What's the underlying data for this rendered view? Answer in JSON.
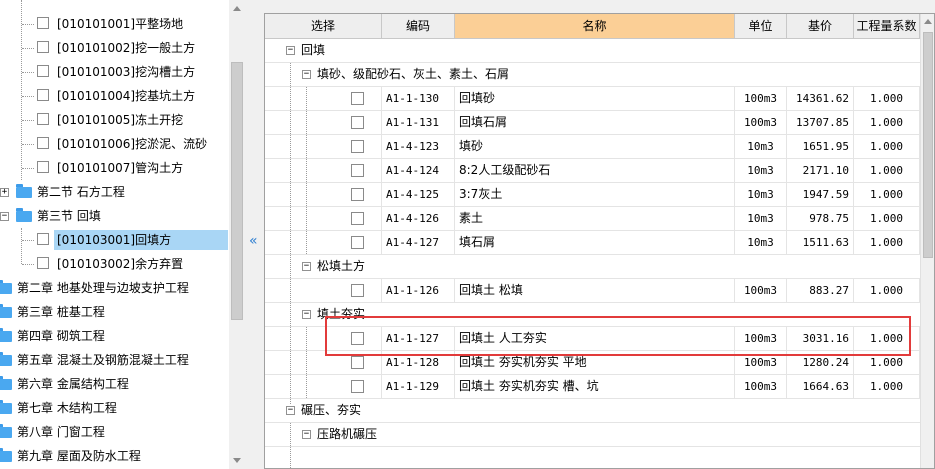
{
  "tree": {
    "items": [
      {
        "label": "[010101001]平整场地",
        "kind": "leaf"
      },
      {
        "label": "[010101002]挖一般土方",
        "kind": "leaf"
      },
      {
        "label": "[010101003]挖沟槽土方",
        "kind": "leaf"
      },
      {
        "label": "[010101004]挖基坑土方",
        "kind": "leaf"
      },
      {
        "label": "[010101005]冻土开挖",
        "kind": "leaf"
      },
      {
        "label": "[010101006]挖淤泥、流砂",
        "kind": "leaf"
      },
      {
        "label": "[010101007]管沟土方",
        "kind": "leaf"
      },
      {
        "label": "第二节   石方工程",
        "kind": "section",
        "expander": "+"
      },
      {
        "label": "第三节   回填",
        "kind": "section",
        "expander": "−"
      },
      {
        "label": "[010103001]回填方",
        "kind": "leaf",
        "selected": true
      },
      {
        "label": "[010103002]余方弃置",
        "kind": "leaf"
      },
      {
        "label": "第二章   地基处理与边坡支护工程",
        "kind": "chapter"
      },
      {
        "label": "第三章   桩基工程",
        "kind": "chapter"
      },
      {
        "label": "第四章   砌筑工程",
        "kind": "chapter"
      },
      {
        "label": "第五章   混凝土及钢筋混凝土工程",
        "kind": "chapter"
      },
      {
        "label": "第六章   金属结构工程",
        "kind": "chapter"
      },
      {
        "label": "第七章   木结构工程",
        "kind": "chapter"
      },
      {
        "label": "第八章   门窗工程",
        "kind": "chapter"
      },
      {
        "label": "第九章   屋面及防水工程",
        "kind": "chapter"
      }
    ]
  },
  "grid": {
    "headers": [
      "选择",
      "编码",
      "名称",
      "单位",
      "基价",
      "工程量系数"
    ],
    "groups": {
      "g1": "回填",
      "g1a": "填砂、级配砂石、灰土、素土、石屑",
      "g1b": "松填土方",
      "g1c": "填土夯实",
      "g2": "碾压、夯实",
      "g2a": "压路机碾压"
    },
    "rows": [
      {
        "code": "A1-1-130",
        "name": "回填砂",
        "unit": "100m3",
        "price": "14361.62",
        "coef": "1.000"
      },
      {
        "code": "A1-1-131",
        "name": "回填石屑",
        "unit": "100m3",
        "price": "13707.85",
        "coef": "1.000"
      },
      {
        "code": "A1-4-123",
        "name": "填砂",
        "unit": "10m3",
        "price": "1651.95",
        "coef": "1.000"
      },
      {
        "code": "A1-4-124",
        "name": "8:2人工级配砂石",
        "unit": "10m3",
        "price": "2171.10",
        "coef": "1.000"
      },
      {
        "code": "A1-4-125",
        "name": "3:7灰土",
        "unit": "10m3",
        "price": "1947.59",
        "coef": "1.000"
      },
      {
        "code": "A1-4-126",
        "name": "素土",
        "unit": "10m3",
        "price": "978.75",
        "coef": "1.000"
      },
      {
        "code": "A1-4-127",
        "name": "填石屑",
        "unit": "10m3",
        "price": "1511.63",
        "coef": "1.000"
      },
      {
        "code": "A1-1-126",
        "name": "回填土 松填",
        "unit": "100m3",
        "price": "883.27",
        "coef": "1.000"
      },
      {
        "code": "A1-1-127",
        "name": "回填土 人工夯实",
        "unit": "100m3",
        "price": "3031.16",
        "coef": "1.000"
      },
      {
        "code": "A1-1-128",
        "name": "回填土 夯实机夯实 平地",
        "unit": "100m3",
        "price": "1280.24",
        "coef": "1.000"
      },
      {
        "code": "A1-1-129",
        "name": "回填土 夯实机夯实 槽、坑",
        "unit": "100m3",
        "price": "1664.63",
        "coef": "1.000"
      }
    ]
  },
  "colors": {
    "header_active": "#fbcf96",
    "selected": "#a9d6f5",
    "highlight": "#e23b3b",
    "folder": "#4aa8f0"
  },
  "icons": {
    "folder": "folder-icon",
    "checkbox": "checkbox-icon",
    "collapse": "collapse-panel-icon"
  }
}
